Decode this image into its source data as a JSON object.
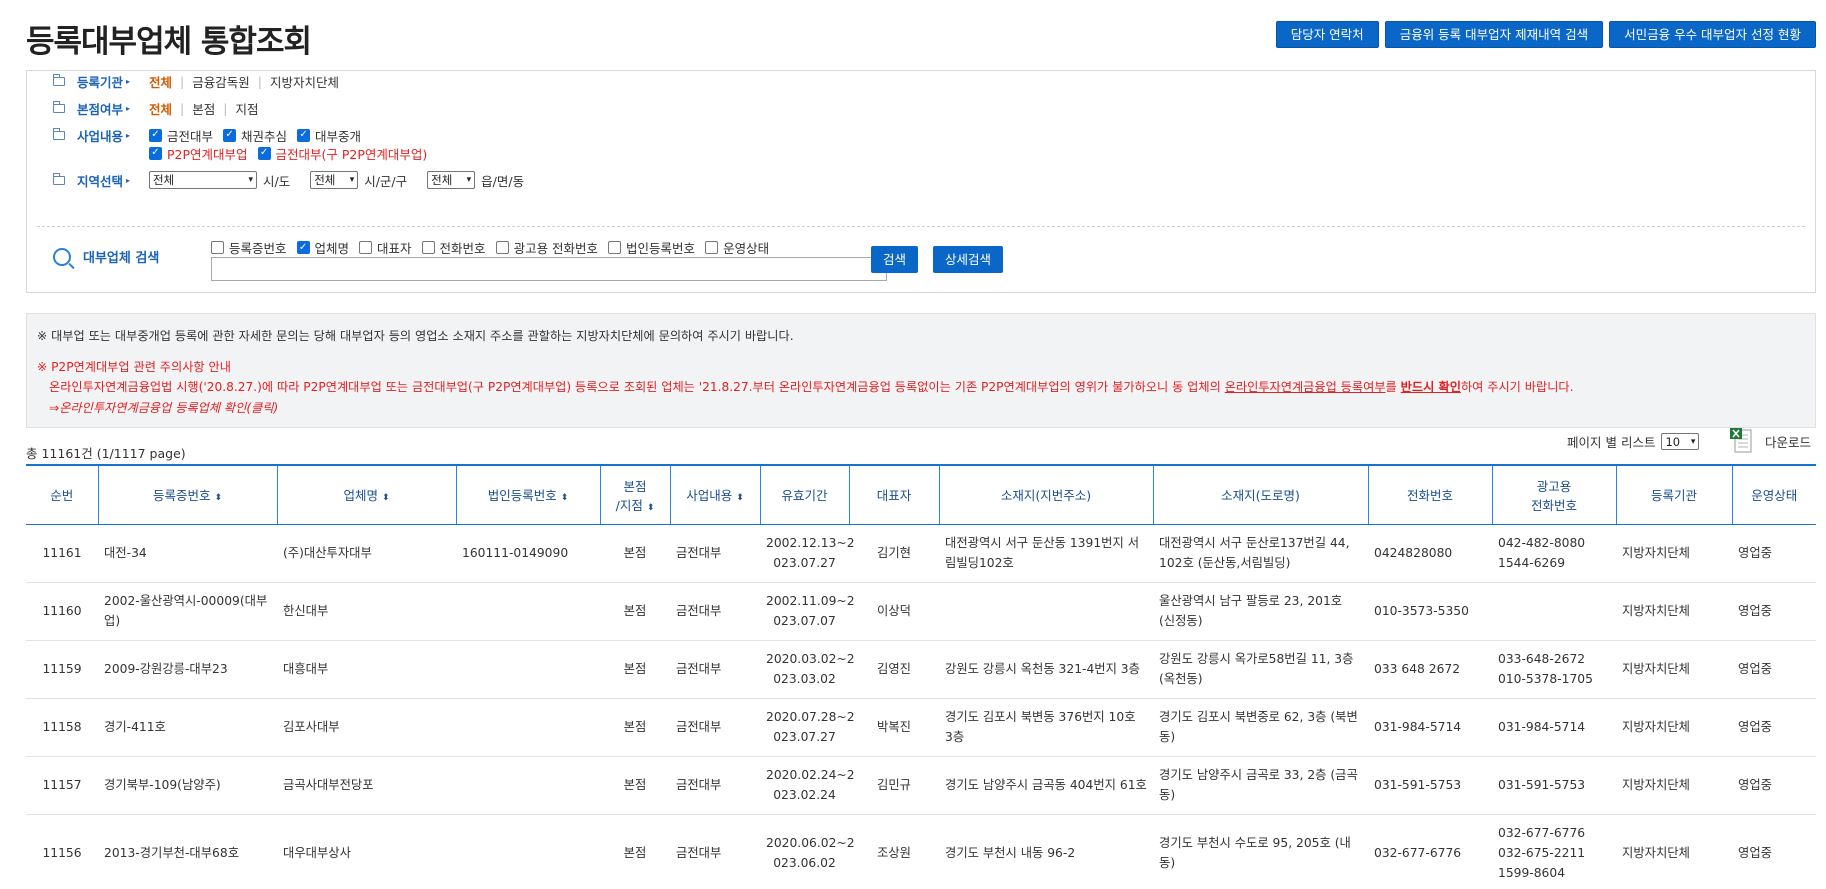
{
  "page_title": "등록대부업체 통합조회",
  "top_buttons": [
    "담당자 연락처",
    "금융위 등록 대부업자 제재내역 검색",
    "서민금융 우수 대부업자 선정 현황"
  ],
  "filters": {
    "registry": {
      "label": "등록기관",
      "options": [
        "전체",
        "금융감독원",
        "지방자치단체"
      ],
      "selected": "전체"
    },
    "branch": {
      "label": "본점여부",
      "options": [
        "전체",
        "본점",
        "지점"
      ],
      "selected": "전체"
    },
    "business": {
      "label": "사업내용",
      "options": [
        "금전대부",
        "채권추심",
        "대부중개",
        "P2P연계대부업",
        "금전대부(구 P2P연계대부업)"
      ]
    },
    "region": {
      "label": "지역선택",
      "sido": "전체",
      "sido_unit": "시/도",
      "sigungu": "전체",
      "sigungu_unit": "시/군/구",
      "dong": "전체",
      "dong_unit": "읍/면/동"
    }
  },
  "search": {
    "label": "대부업체 검색",
    "fields": [
      {
        "label": "등록증번호",
        "checked": false
      },
      {
        "label": "업체명",
        "checked": true
      },
      {
        "label": "대표자",
        "checked": false
      },
      {
        "label": "전화번호",
        "checked": false
      },
      {
        "label": "광고용 전화번호",
        "checked": false
      },
      {
        "label": "법인등록번호",
        "checked": false
      },
      {
        "label": "운영상태",
        "checked": false
      }
    ],
    "value": "",
    "search_btn": "검색",
    "detail_btn": "상세검색"
  },
  "notice": {
    "line1": "※ 대부업 또는 대부중개업 등록에 관한 자세한 문의는 당해 대부업자 등의 영업소 소재지 주소를 관할하는 지방자치단체에 문의하여 주시기 바랍니다.",
    "line2": "※ P2P연계대부업 관련 주의사항 안내",
    "line3a": "온라인투자연계금융업법 시행('20.8.27.)에 따라 P2P연계대부업 또는 금전대부업(구 P2P연계대부업) 등록으로 조회된 업체는 '21.8.27.부터 온라인투자연계금융업 등록없이는 기존 P2P연계대부업의 영위가 불가하오니 동 업체의 ",
    "line3b": "온라인투자연계금융업 등록여부",
    "line3c": "를 ",
    "line3d": "반드시 확인",
    "line3e": "하여 주시기 바랍니다.",
    "line4": "⇒온라인투자연계금융업 등록업체 확인(클릭)"
  },
  "total_text": "총 11161건 (1/1117 page)",
  "per_page_label": "페이지 별 리스트",
  "per_page_value": "10",
  "download_label": "다운로드",
  "table": {
    "headers": [
      "순번",
      "등록증번호",
      "업체명",
      "법인등록번호",
      "본점",
      "/지점",
      "사업내용",
      "유효기간",
      "대표자",
      "소재지(지번주소)",
      "소재지(도로명)",
      "전화번호",
      "광고용",
      "전화번호",
      "등록기관",
      "운영상태"
    ],
    "rows": [
      {
        "no": "11161",
        "reg": "대전-34",
        "name": "(주)대산투자대부",
        "corp": "160111-0149090",
        "branch": "본점",
        "biz": "금전대부",
        "period1": "2002.12.13~2",
        "period2": "023.07.27",
        "rep": "김기현",
        "addr1": "대전광역시 서구 둔산동 1391번지 서림빌딩102호",
        "addr2": "대전광역시 서구 둔산로137번길 44, 102호 (둔산동,서림빌딩)",
        "tel": "0424828080",
        "ad1": "042-482-8080",
        "ad2": "1544-6269",
        "ad3": "",
        "agency": "지방자치단체",
        "status": "영업중"
      },
      {
        "no": "11160",
        "reg": "2002-울산광역시-00009(대부업)",
        "name": "한신대부",
        "corp": "",
        "branch": "본점",
        "biz": "금전대부",
        "period1": "2002.11.09~2",
        "period2": "023.07.07",
        "rep": "이상덕",
        "addr1": "",
        "addr2": "울산광역시 남구 팔등로 23, 201호 (신정동)",
        "tel": "010-3573-5350",
        "ad1": "",
        "ad2": "",
        "ad3": "",
        "agency": "지방자치단체",
        "status": "영업중"
      },
      {
        "no": "11159",
        "reg": "2009-강원강릉-대부23",
        "name": "대흥대부",
        "corp": "",
        "branch": "본점",
        "biz": "금전대부",
        "period1": "2020.03.02~2",
        "period2": "023.03.02",
        "rep": "김영진",
        "addr1": "강원도 강릉시 옥천동 321-4번지 3층",
        "addr2": "강원도 강릉시 옥가로58번길 11, 3층 (옥천동)",
        "tel": "033 648 2672",
        "ad1": "033-648-2672",
        "ad2": "010-5378-1705",
        "ad3": "",
        "agency": "지방자치단체",
        "status": "영업중"
      },
      {
        "no": "11158",
        "reg": "경기-411호",
        "name": "김포사대부",
        "corp": "",
        "branch": "본점",
        "biz": "금전대부",
        "period1": "2020.07.28~2",
        "period2": "023.07.27",
        "rep": "박복진",
        "addr1": "경기도 김포시 북변동 376번지 10호 3층",
        "addr2": "경기도 김포시 북변중로 62, 3층 (북변동)",
        "tel": "031-984-5714",
        "ad1": "031-984-5714",
        "ad2": "",
        "ad3": "",
        "agency": "지방자치단체",
        "status": "영업중"
      },
      {
        "no": "11157",
        "reg": "경기북부-109(남양주)",
        "name": "금곡사대부전당포",
        "corp": "",
        "branch": "본점",
        "biz": "금전대부",
        "period1": "2020.02.24~2",
        "period2": "023.02.24",
        "rep": "김민규",
        "addr1": "경기도 남양주시 금곡동 404번지 61호",
        "addr2": "경기도 남양주시 금곡로 33, 2층 (금곡동)",
        "tel": "031-591-5753",
        "ad1": "031-591-5753",
        "ad2": "",
        "ad3": "",
        "agency": "지방자치단체",
        "status": "영업중"
      },
      {
        "no": "11156",
        "reg": "2013-경기부천-대부68호",
        "name": "대우대부상사",
        "corp": "",
        "branch": "본점",
        "biz": "금전대부",
        "period1": "2020.06.02~2",
        "period2": "023.06.02",
        "rep": "조상원",
        "addr1": "경기도 부천시 내동 96-2",
        "addr2": "경기도 부천시 수도로 95, 205호 (내동)",
        "tel": "032-677-6776",
        "ad1": "032-677-6776",
        "ad2": "032-675-2211",
        "ad3": "1599-8604",
        "agency": "지방자치단체",
        "status": "영업중"
      }
    ]
  }
}
